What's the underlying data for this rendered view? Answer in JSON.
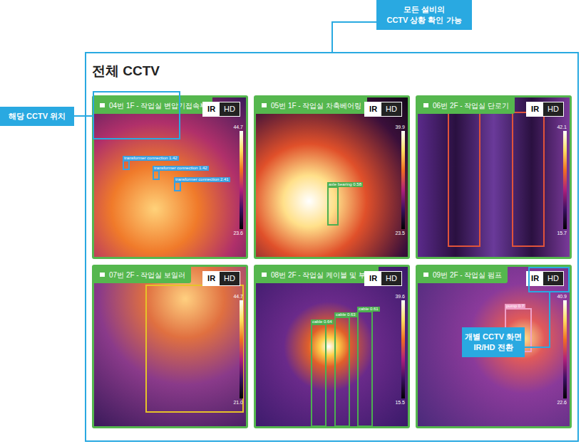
{
  "callouts": {
    "top": {
      "lines": [
        "모든 설비의",
        "CCTV 상황 확인 가능"
      ]
    },
    "left": {
      "lines": [
        "해당 CCTV 위치"
      ]
    },
    "toggle": {
      "lines": [
        "개별 CCTV 화면",
        "IR/HD 전환"
      ]
    }
  },
  "panel": {
    "title": "전체 CCTV"
  },
  "cameras": [
    {
      "name": "04번 1F - 작업실 변압기접속부",
      "scale_max": "44.7",
      "scale_min": "23.6",
      "modes": [
        {
          "label": "IR",
          "selected": true
        },
        {
          "label": "HD",
          "selected": false
        }
      ],
      "detections": [
        {
          "label": "transformer connection 1.42",
          "color": "#3aa0e0"
        },
        {
          "label": "transformer connection 1.42",
          "color": "#3aa0e0"
        },
        {
          "label": "transformer connection 2.41",
          "color": "#3aa0e0"
        }
      ]
    },
    {
      "name": "05번 1F - 작업실 차축베어링",
      "scale_max": "39.9",
      "scale_min": "23.5",
      "modes": [
        {
          "label": "IR",
          "selected": true
        },
        {
          "label": "HD",
          "selected": false
        }
      ],
      "detections": [
        {
          "label": "axle bearing 0.58",
          "color": "#4caf50"
        }
      ]
    },
    {
      "name": "06번 2F - 작업실 단로기",
      "scale_max": "42.1",
      "scale_min": "15.7",
      "modes": [
        {
          "label": "IR",
          "selected": true
        },
        {
          "label": "HD",
          "selected": false
        }
      ],
      "detections": [
        {
          "label": "",
          "color": "#e0533a"
        },
        {
          "label": "",
          "color": "#e0533a"
        }
      ]
    },
    {
      "name": "07번 2F - 작업실 보일러",
      "scale_max": "44.7",
      "scale_min": "21.0",
      "modes": [
        {
          "label": "IR",
          "selected": true
        },
        {
          "label": "HD",
          "selected": false
        }
      ],
      "detections": [
        {
          "label": "",
          "color": "#e6c229"
        }
      ]
    },
    {
      "name": "08번 2F - 작업실 케이블 및 부스",
      "scale_max": "39.6",
      "scale_min": "15.5",
      "modes": [
        {
          "label": "IR",
          "selected": true
        },
        {
          "label": "HD",
          "selected": false
        }
      ],
      "detections": [
        {
          "label": "cable 0.64",
          "color": "#4caf50"
        },
        {
          "label": "cable 0.63",
          "color": "#4caf50"
        },
        {
          "label": "cable 0.61",
          "color": "#4caf50"
        }
      ]
    },
    {
      "name": "09번 2F - 작업실 펌프",
      "scale_max": "40.9",
      "scale_min": "22.6",
      "modes": [
        {
          "label": "IR",
          "selected": true
        },
        {
          "label": "HD",
          "selected": false
        }
      ],
      "detections": [
        {
          "label": "pump 0.7",
          "color": "#f0a0c8"
        }
      ]
    }
  ]
}
